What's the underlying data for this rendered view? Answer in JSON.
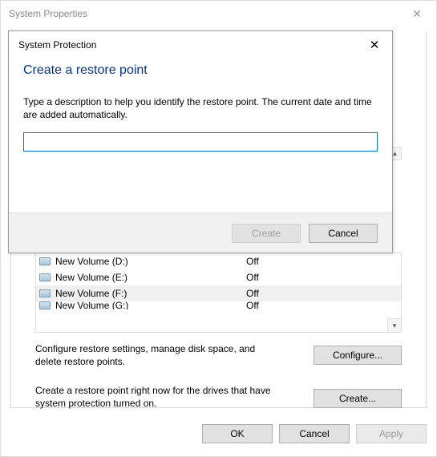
{
  "parent": {
    "title": "System Properties"
  },
  "modal": {
    "title": "System Protection",
    "heading": "Create a restore point",
    "description": "Type a description to help you identify the restore point. The current date and time are added automatically.",
    "input_value": "",
    "create_label": "Create",
    "cancel_label": "Cancel"
  },
  "drives": [
    {
      "name": "New Volume (D:)",
      "status": "Off"
    },
    {
      "name": "New Volume (E:)",
      "status": "Off"
    },
    {
      "name": "New Volume (F:)",
      "status": "Off"
    },
    {
      "name": "New Volume (G:)",
      "status": "Off"
    }
  ],
  "config": {
    "text": "Configure restore settings, manage disk space, and delete restore points.",
    "button": "Configure..."
  },
  "create": {
    "text": "Create a restore point right now for the drives that have system protection turned on.",
    "button": "Create..."
  },
  "footer": {
    "ok": "OK",
    "cancel": "Cancel",
    "apply": "Apply"
  }
}
